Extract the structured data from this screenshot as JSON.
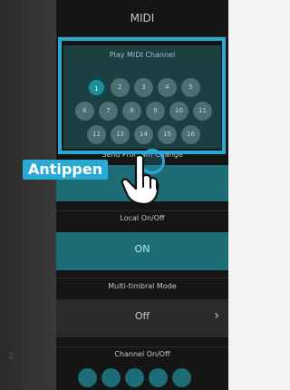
{
  "screen": {
    "title": "MIDI"
  },
  "play_channel": {
    "title": "Play MIDI Channel",
    "channels": [
      "1",
      "2",
      "3",
      "4",
      "5",
      "6",
      "7",
      "8",
      "9",
      "10",
      "11",
      "12",
      "13",
      "14",
      "15",
      "16"
    ],
    "selected": "1"
  },
  "send_program_change": {
    "label": "Send Program Change"
  },
  "local": {
    "label": "Local On/Off",
    "value": "ON"
  },
  "multi_timbral": {
    "label": "Multi-timbral Mode",
    "value": "Off"
  },
  "channel_onoff": {
    "label": "Channel On/Off"
  },
  "overlay": {
    "tap_label": "Antippen"
  },
  "colors": {
    "accent": "#2aa9d5",
    "teal": "#1d6d76",
    "active_channel": "#1d8e98"
  }
}
